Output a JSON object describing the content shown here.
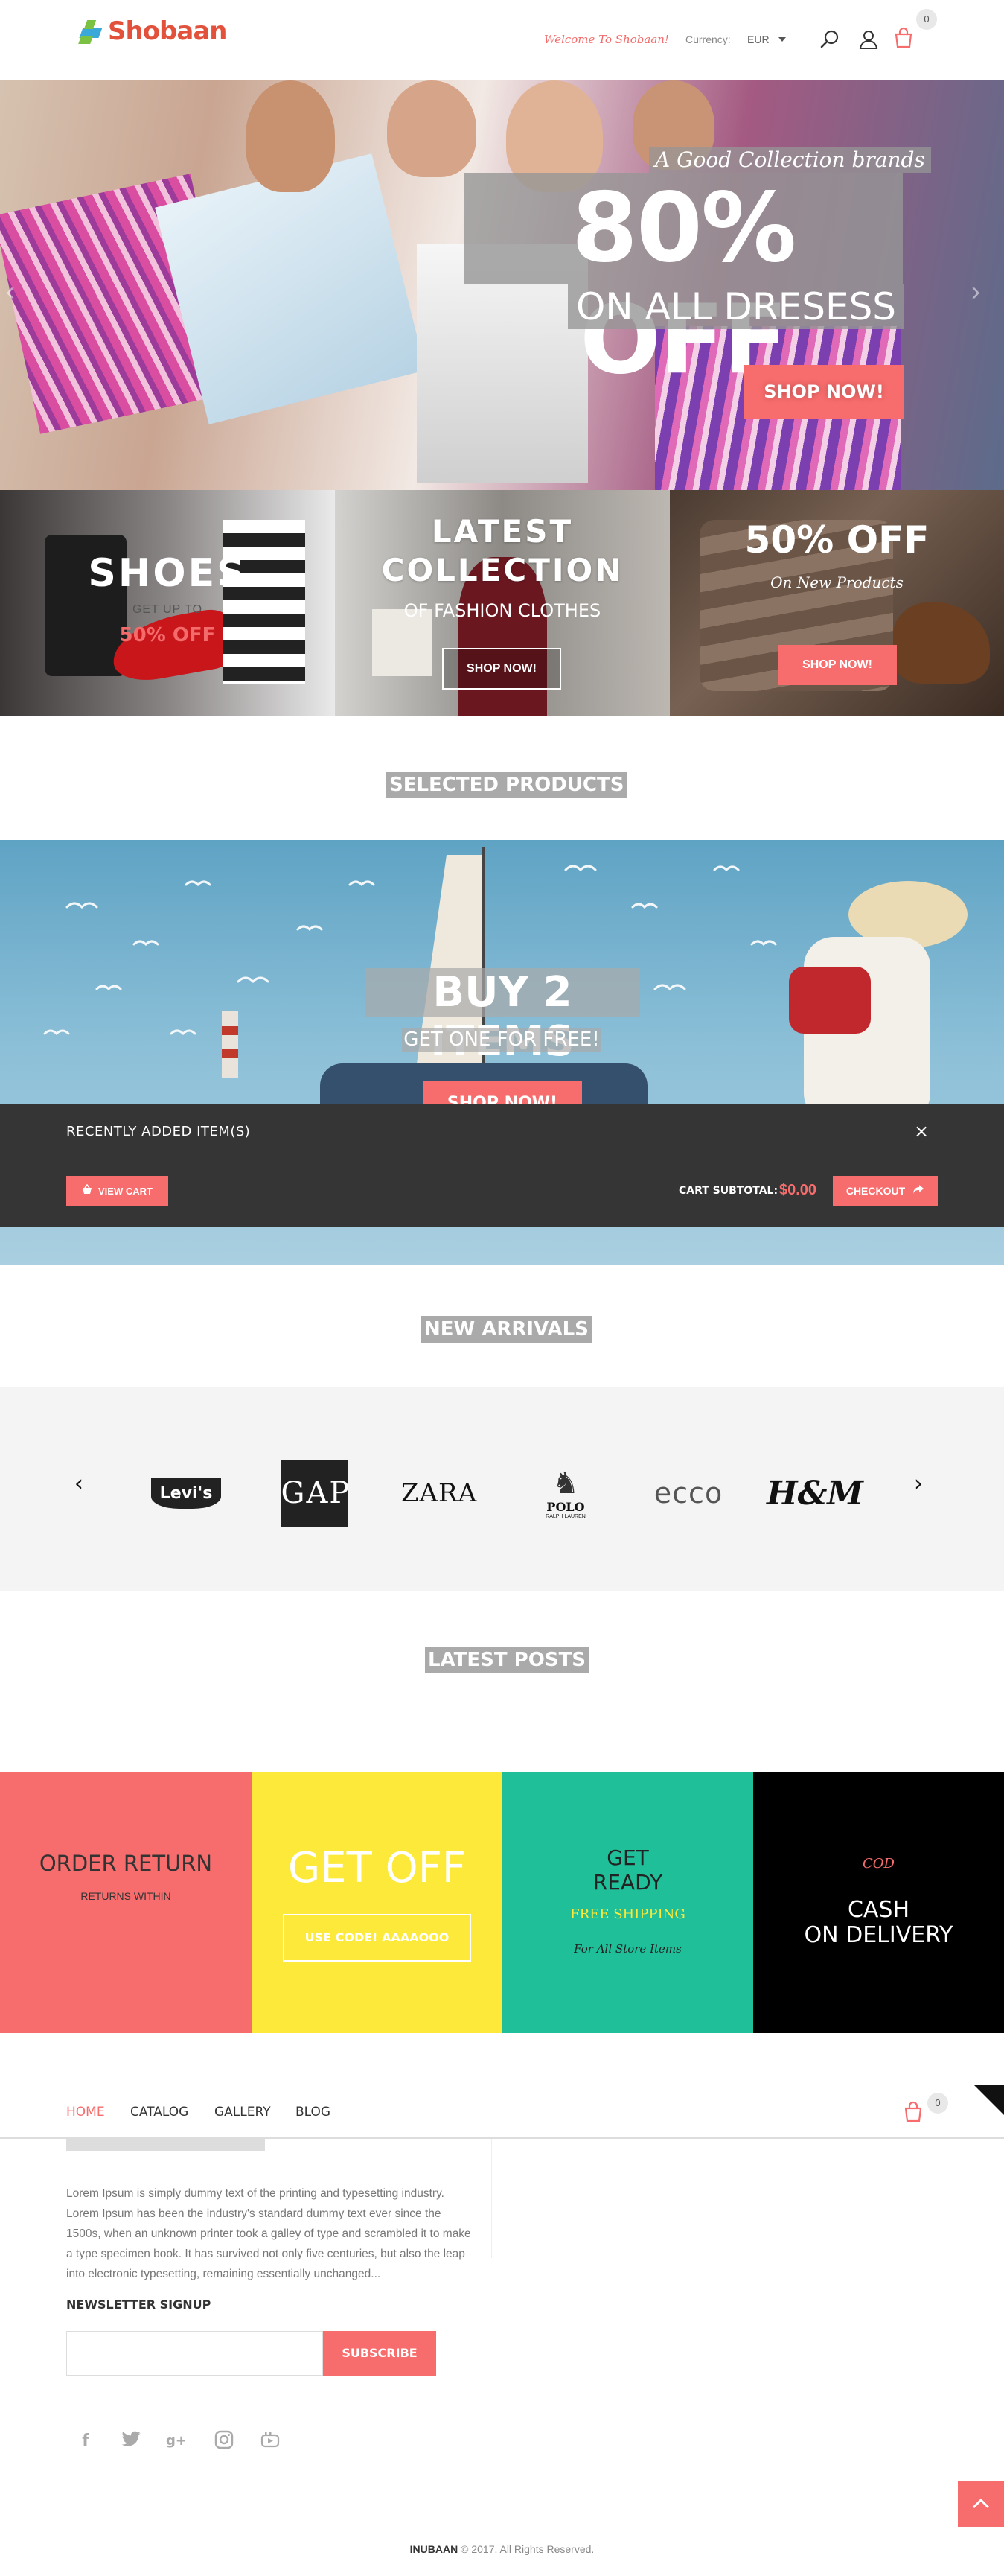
{
  "brand": {
    "name": "Shobaan"
  },
  "header": {
    "welcome": "Welcome To Shobaan!",
    "currency_label": "Currency:",
    "currency_value": "EUR",
    "cart_count": "0"
  },
  "hero": {
    "tagline": "A Good Collection brands",
    "discount": "80% OFF",
    "subtitle": "ON ALL DRESESS",
    "button": "SHOP NOW!"
  },
  "banners": [
    {
      "title": "SHOES",
      "line1": "GET UP TO",
      "line2": "50% OFF"
    },
    {
      "title_line1": "LATEST",
      "title_line2": "COLLECTION",
      "subtitle": "OF FASHION CLOTHES",
      "button": "SHOP NOW!"
    },
    {
      "title": "50% OFF",
      "subtitle": "On New Products",
      "button": "SHOP NOW!"
    }
  ],
  "sections": {
    "selected": "SELECTED PRODUCTS",
    "new_arrivals": "NEW ARRIVALS",
    "latest_posts": "LATEST POSTS"
  },
  "promo": {
    "title": "BUY 2 ITEMS",
    "subtitle": "GET ONE FOR FREE!",
    "button": "SHOP NOW!"
  },
  "minicart": {
    "title": "RECENTLY ADDED ITEM(S)",
    "view_cart": "VIEW CART",
    "subtotal_label": "CART SUBTOTAL:",
    "subtotal_value": "$0.00",
    "checkout": "CHECKOUT"
  },
  "brands": [
    "Levi's",
    "GAP",
    "ZARA",
    "POLO",
    "ecco",
    "H&M"
  ],
  "brand_sub": {
    "polo": "RALPH LAUREN"
  },
  "services": [
    {
      "title": "ORDER RETURN",
      "subtitle": "RETURNS WITHIN",
      "color": "#f76c6c"
    },
    {
      "title": "GET OFF",
      "button": "USE CODE! AAAAOOO",
      "color": "#fde939"
    },
    {
      "title_line1": "GET",
      "title_line2": "READY",
      "highlight": "FREE SHIPPING",
      "caption": "For All Store Items",
      "color": "#1fbf9a"
    },
    {
      "label": "COD",
      "title_line1": "CASH",
      "title_line2": "ON DELIVERY",
      "color": "#000000"
    }
  ],
  "footer": {
    "nav": [
      "HOME",
      "CATALOG",
      "GALLERY",
      "BLOG"
    ],
    "cart_count": "0",
    "about": "Lorem Ipsum is simply dummy text of the printing and typesetting industry. Lorem Ipsum has been the industry's standard dummy text ever since the 1500s, when an unknown printer took a galley of type and scrambled it to make a type specimen book. It has survived not only five centuries, but also the leap into electronic typesetting, remaining essentially unchanged...",
    "newsletter_label": "NEWSLETTER SIGNUP",
    "newsletter_placeholder": "",
    "subscribe": "SUBSCRIBE",
    "social": [
      "facebook-icon",
      "twitter-icon",
      "google-plus-icon",
      "instagram-icon",
      "youtube-icon"
    ],
    "copyright_brand": "INUBAAN",
    "copyright_rest": " © 2017. All Rights Reserved."
  },
  "colors": {
    "accent": "#f76c6c",
    "dark": "#353535"
  }
}
